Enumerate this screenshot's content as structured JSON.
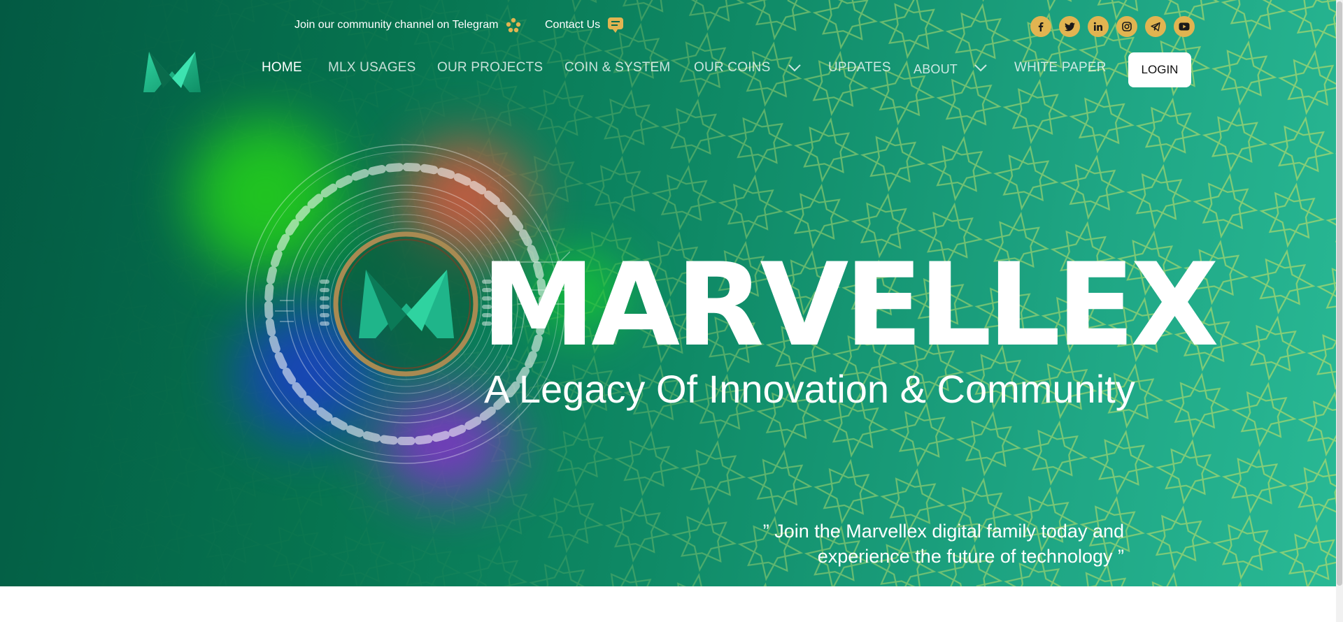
{
  "topbar": {
    "telegram_text": "Join our community channel on Telegram",
    "telegram_icon": "community-people-icon",
    "contact_text": "Contact Us",
    "contact_icon": "chat-bubble-icon",
    "social": [
      {
        "name": "facebook-icon",
        "glyph": "f"
      },
      {
        "name": "twitter-icon",
        "glyph": ""
      },
      {
        "name": "linkedin-icon",
        "glyph": "in"
      },
      {
        "name": "instagram-icon",
        "glyph": ""
      },
      {
        "name": "telegram-icon",
        "glyph": ""
      },
      {
        "name": "youtube-icon",
        "glyph": ""
      }
    ]
  },
  "nav": {
    "items": [
      {
        "label": "HOME"
      },
      {
        "label": "MLX USAGES"
      },
      {
        "label": "OUR PROJECTS"
      },
      {
        "label": "COIN & SYSTEM"
      },
      {
        "label": "OUR COINS"
      },
      {
        "label": "UPDATES"
      },
      {
        "label": "ABOUT"
      },
      {
        "label": "WHITE PAPER"
      }
    ],
    "login_label": "LOGIN"
  },
  "hero": {
    "title": "MARVELLEX",
    "subtitle": "A Legacy Of Innovation & Community",
    "quote_line1": "” Join the Marvellex digital family today and",
    "quote_line2": "experience the future of technology ”"
  },
  "colors": {
    "accent_gold": "#e1b451",
    "bg_dark_green": "#035a43",
    "bg_light_green": "#29b995",
    "pattern_lines": "#8fcd6a"
  }
}
